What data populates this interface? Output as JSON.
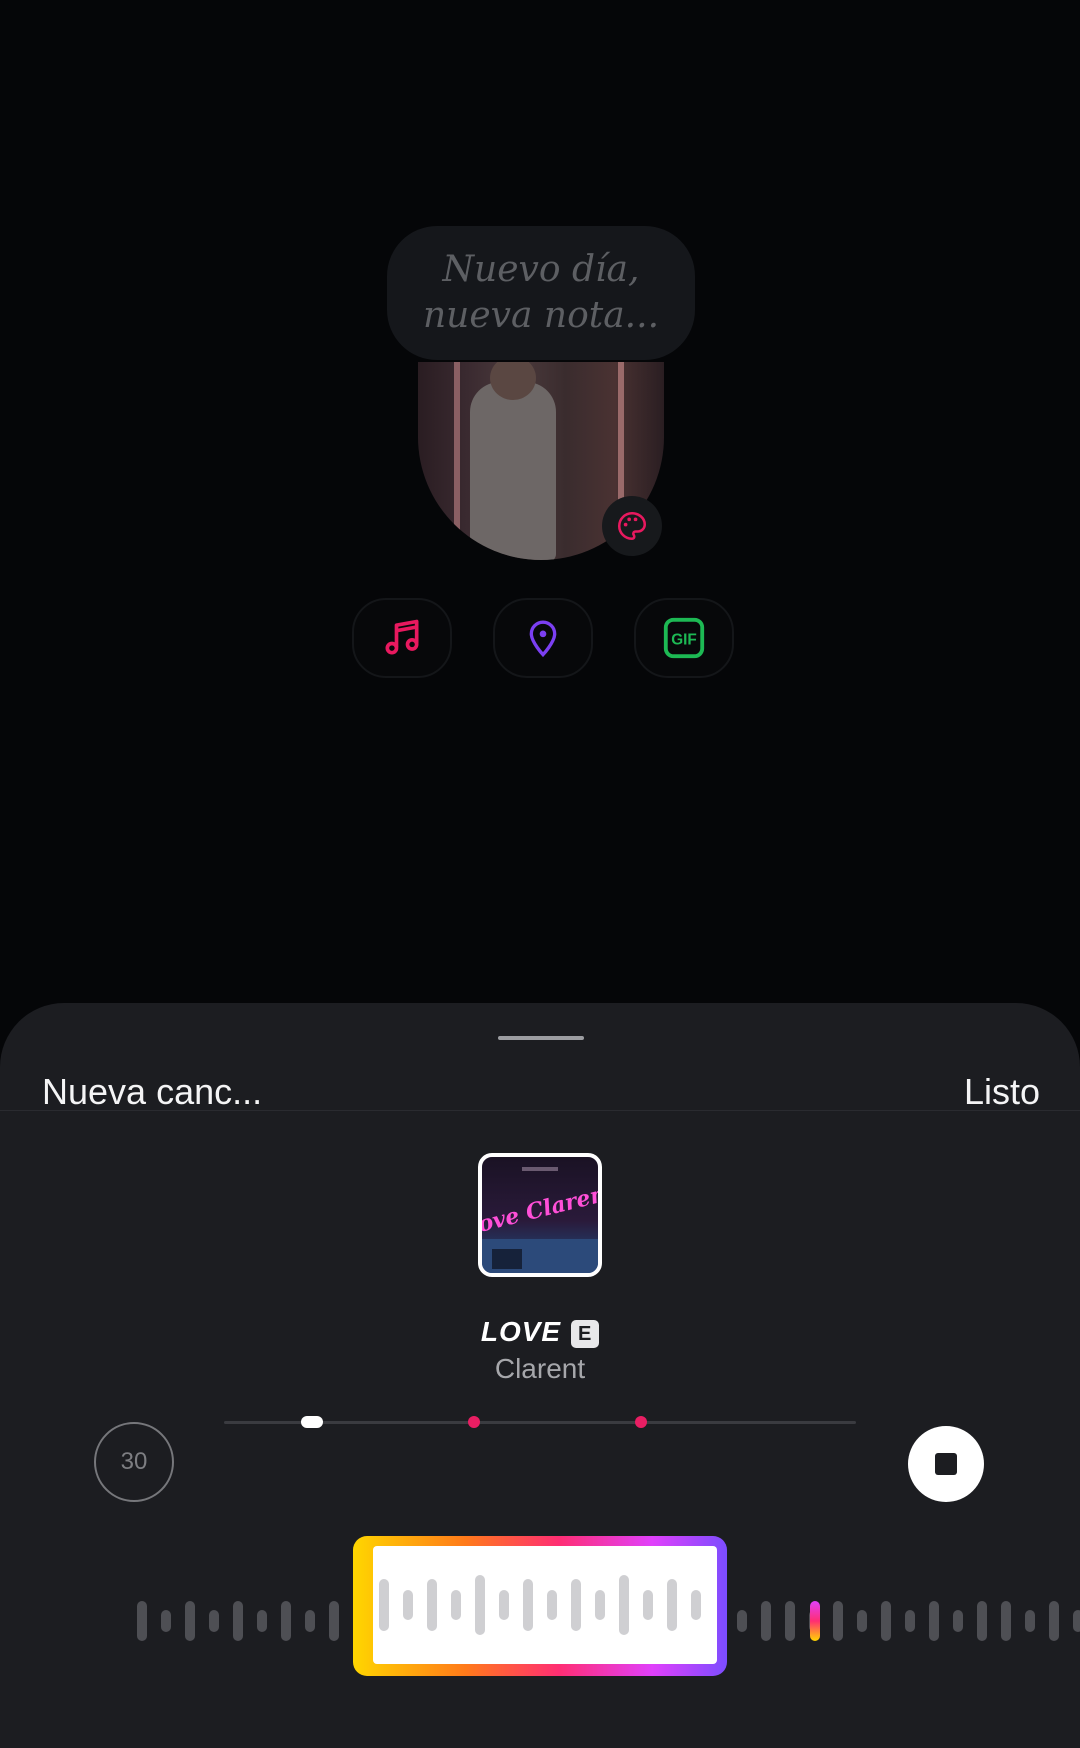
{
  "note": {
    "placeholder_line1": "Nuevo día,",
    "placeholder_line2": "nueva nota..."
  },
  "tools": [
    {
      "name": "music-icon",
      "color": "#e8195f"
    },
    {
      "name": "location-pin-icon",
      "color": "#7b3ff2"
    },
    {
      "name": "gif-icon",
      "label": "GIF",
      "color": "#1db954"
    }
  ],
  "sheet": {
    "title": "Nueva canc...",
    "done_label": "Listo"
  },
  "song": {
    "title": "LOVE",
    "explicit_badge": "E",
    "artist": "Clarent",
    "cover_text": "Love Clarent"
  },
  "player": {
    "duration_seconds": "30",
    "playhead_fraction": 0.14,
    "highlight_markers": [
      0.395,
      0.66
    ],
    "selection_start_fraction": 0.33,
    "selection_end_fraction": 0.67
  },
  "colors": {
    "background": "#050608",
    "sheet": "#1c1d21",
    "accent_pink": "#e81e63"
  }
}
